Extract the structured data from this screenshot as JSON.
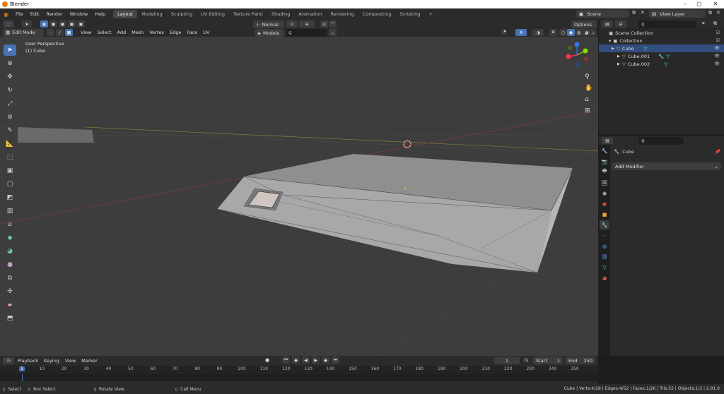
{
  "window": {
    "title": "Blender"
  },
  "menu": {
    "items": [
      "File",
      "Edit",
      "Render",
      "Window",
      "Help"
    ]
  },
  "workspaces": [
    "Layout",
    "Modeling",
    "Sculpting",
    "UV Editing",
    "Texture Paint",
    "Shading",
    "Animation",
    "Rendering",
    "Compositing",
    "Scripting"
  ],
  "active_workspace": "Layout",
  "scene": {
    "label": "Scene",
    "view_layer": "View Layer"
  },
  "viewport_header": {
    "mode": "Edit Mode",
    "menus": [
      "View",
      "Select",
      "Add",
      "Mesh",
      "Vertex",
      "Edge",
      "Face",
      "UV"
    ],
    "orientation": "Normal",
    "options": "Options",
    "snap_target": "Models"
  },
  "viewport": {
    "perspective": "User Perspective",
    "object": "(1) Cube"
  },
  "outliner": {
    "root": "Scene Collection",
    "collection": "Collection",
    "objects": [
      {
        "name": "Cube",
        "selected": true
      },
      {
        "name": "Cube.001",
        "selected": false
      },
      {
        "name": "Cube.002",
        "selected": false
      }
    ]
  },
  "properties": {
    "object": "Cube",
    "add_modifier": "Add Modifier"
  },
  "timeline": {
    "menus": [
      "Playback",
      "Keying",
      "View",
      "Marker"
    ],
    "current_frame": "1",
    "start_label": "Start",
    "start": "1",
    "end_label": "End",
    "end": "250",
    "ticks": [
      "1",
      "10",
      "20",
      "30",
      "40",
      "50",
      "60",
      "70",
      "80",
      "90",
      "100",
      "110",
      "120",
      "130",
      "140",
      "150",
      "160",
      "170",
      "180",
      "190",
      "200",
      "210",
      "220",
      "230",
      "240",
      "250"
    ]
  },
  "statusbar": {
    "select": "Select",
    "box_select": "Box Select",
    "rotate_view": "Rotate View",
    "call_menu": "Call Menu",
    "stats": "Cube | Verts:4/28 | Edges:4/52 | Faces:1/26 | Tris:52 | Objects:1/3 | 2.91.0"
  },
  "colors": {
    "accent": "#4772b3",
    "selection": "#334d80",
    "viewport_bg": "#3d3d3d",
    "panel_bg": "#2b2b2b"
  }
}
